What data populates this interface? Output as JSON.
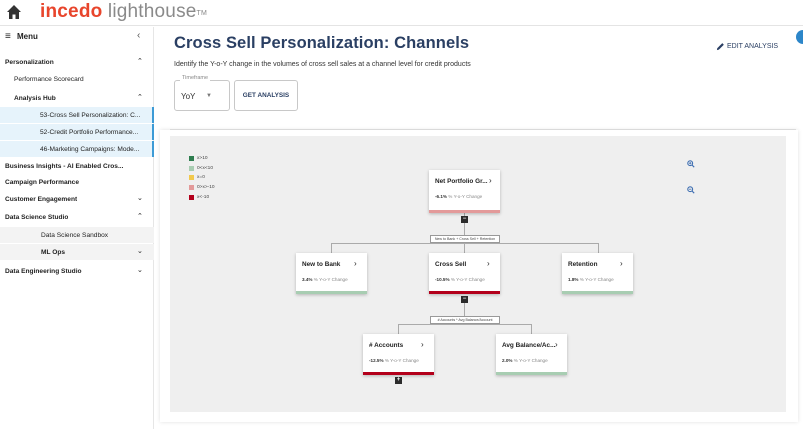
{
  "app": {
    "brand_primary": "incedo",
    "brand_secondary": "lighthouse",
    "brand_tm": "TM",
    "brand_color": "#e8452c"
  },
  "sidebar": {
    "menu_icon": "≡",
    "menu_label": "Menu",
    "collapse_chevron": "‹",
    "items": [
      {
        "label": "Personalization",
        "caret": "⌃"
      },
      {
        "label": "Performance Scorecard"
      },
      {
        "label": "Analysis Hub",
        "caret": "⌃"
      },
      {
        "label": "53-Cross Sell Personalization: C..."
      },
      {
        "label": "52-Credit Portfolio Performance..."
      },
      {
        "label": "46-Marketing Campaigns: Mode..."
      },
      {
        "label": "Business Insights - AI Enabled Cros..."
      },
      {
        "label": "Campaign Performance"
      },
      {
        "label": "Customer Engagement",
        "caret": "⌄"
      },
      {
        "label": "Data Science Studio",
        "caret": "⌃"
      },
      {
        "label": "Data Science Sandbox"
      },
      {
        "label": "ML Ops",
        "caret": "⌄"
      },
      {
        "label": "Data Engineering Studio",
        "caret": "⌄"
      }
    ]
  },
  "main": {
    "title": "Cross Sell Personalization: Channels",
    "subtitle": "Identify the Y-o-Y change in the volumes of cross sell sales at a channel level for credit products",
    "edit_label": "EDIT ANALYSIS",
    "timeframe": {
      "legend": "Timeframe",
      "value": "YoY",
      "caret": "▼"
    },
    "get_analysis_label": "GET ANALYSIS"
  },
  "legend": [
    {
      "label": "x>10",
      "color": "#2e7d4f"
    },
    {
      "label": "0<x<10",
      "color": "#a8cdb2"
    },
    {
      "label": "x=0",
      "color": "#f2c94c"
    },
    {
      "label": "0>x>-10",
      "color": "#e39a9a"
    },
    {
      "label": "x<-10",
      "color": "#b3001b"
    }
  ],
  "tree": {
    "root": {
      "title": "Net Portfolio Gr...",
      "value": "-6.1%",
      "unit": "%",
      "suffix": "Y-o-Y Change",
      "bar_color": "#e39a9a"
    },
    "op1": "New to Bank + Cross Sell + Retention",
    "children": [
      {
        "title": "New to Bank",
        "value": "3.4%",
        "unit": "%",
        "suffix": "Y-o-Y Change",
        "bar_color": "#a8cdb2"
      },
      {
        "title": "Cross Sell",
        "value": "-10.5%",
        "unit": "%",
        "suffix": "Y-o-Y Change",
        "bar_color": "#b3001b"
      },
      {
        "title": "Retention",
        "value": "1.8%",
        "unit": "%",
        "suffix": "Y-o-Y Change",
        "bar_color": "#a8cdb2"
      }
    ],
    "op2": "# Accounts * Avg Balance/Account",
    "grandchildren": [
      {
        "title": "# Accounts",
        "value": "-12.5%",
        "unit": "%",
        "suffix": "Y-o-Y Change",
        "bar_color": "#b3001b"
      },
      {
        "title": "Avg Balance/Ac...",
        "value": "2.0%",
        "unit": "%",
        "suffix": "Y-o-Y Change",
        "bar_color": "#a8cdb2"
      }
    ],
    "arrow": "›",
    "collapse_symbol": "−",
    "expand_symbol": "+"
  }
}
